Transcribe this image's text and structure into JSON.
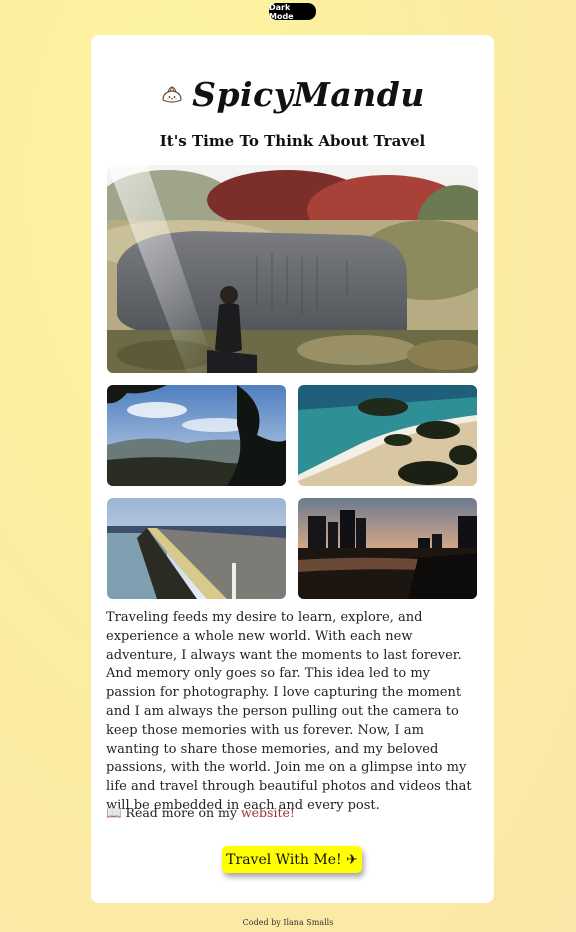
{
  "header": {
    "dark_mode_label": "Dark Mode"
  },
  "brand": {
    "name": "SpicyMandu",
    "icon": "dumpling-icon"
  },
  "subtitle": "It's Time To Think About Travel",
  "gallery": {
    "main_photo": "photo-woman-stone-monument",
    "thumbnails": [
      "photo-mountain-view",
      "photo-rocky-beach",
      "photo-harbor-pier",
      "photo-city-sunset"
    ]
  },
  "body_text": "Traveling feeds my desire to learn, explore, and experience a whole new world. With each new adventure, I always want the moments to last forever. And memory only goes so far. This idea led to my passion for photography. I love capturing the moment and I am always the person pulling out the camera to keep those memories with us forever. Now, I am wanting to share those memories, and my beloved passions, with the world. Join me on a glimpse into my life and travel through beautiful photos and videos that will be embedded in each and every post.",
  "read_more": {
    "icon": "book-icon",
    "prefix": "📖 Read more on my ",
    "link_label": "website!"
  },
  "cta": {
    "label": "Travel With Me! ✈"
  },
  "footer": {
    "credit": "Coded by Ilana Smalls"
  },
  "colors": {
    "background": "#fbeea0",
    "card": "#ffffff",
    "cta": "#ffff00",
    "link": "#a03030",
    "toggle": "#000000"
  }
}
